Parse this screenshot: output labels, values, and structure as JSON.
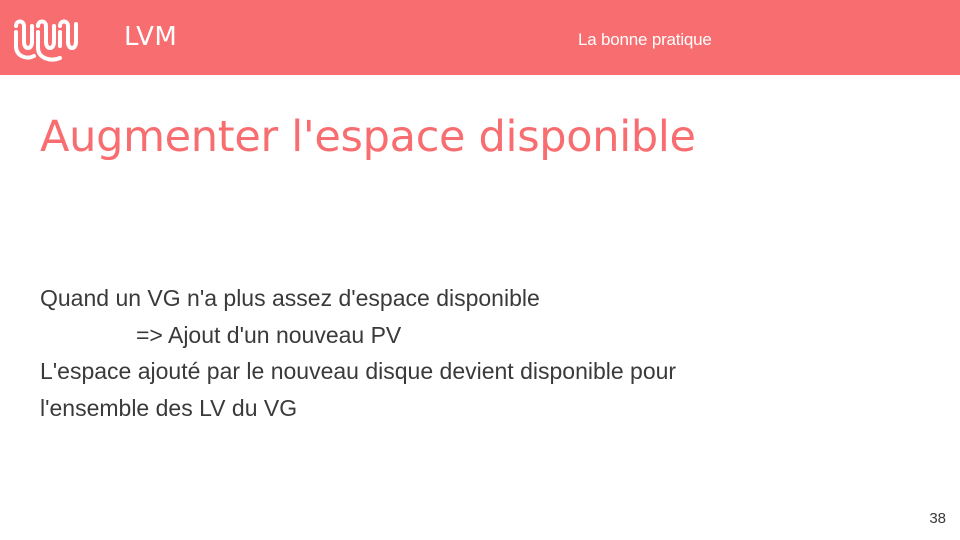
{
  "header": {
    "logo_icon": "wavy-lines-logo-icon",
    "deck_title": "LVM",
    "section_title": "La bonne pratique",
    "background_color": "#f86d6f"
  },
  "slide": {
    "title": "Augmenter l'espace disponible",
    "title_color": "#f86d6f",
    "body_lines": [
      "Quand un VG n'a plus assez d'espace disponible",
      "=> Ajout d'un nouveau PV",
      "L'espace ajouté par le nouveau disque devient disponible pour",
      "l'ensemble des LV du VG"
    ],
    "page_number": "38"
  }
}
